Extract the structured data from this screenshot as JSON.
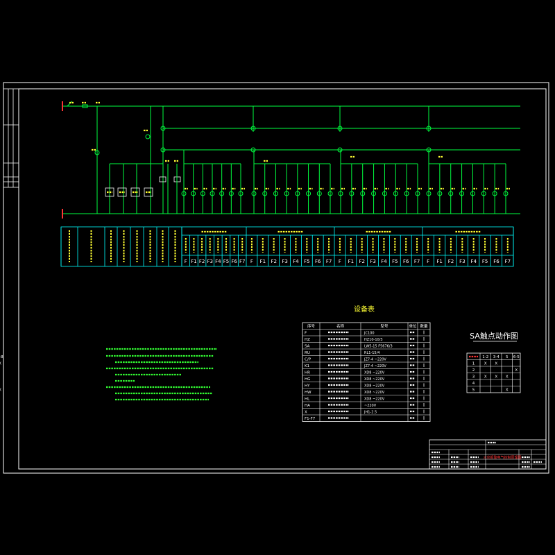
{
  "colors": {
    "frame": "#ffffff",
    "bus": "#00ff3f",
    "table": "#00ffff",
    "notes": "#33ff33",
    "accent_red": "#ff3333",
    "text_yellow": "#ffff33"
  },
  "terminal_row": {
    "codes": [
      "F",
      "F1",
      "F2",
      "F3",
      "F4",
      "F5",
      "F6",
      "F7",
      "F",
      "F1",
      "F2",
      "F3",
      "F4",
      "F5",
      "F6",
      "F7",
      "F",
      "F1",
      "F2",
      "F3",
      "F4",
      "F5",
      "F6",
      "F7",
      "F",
      "F1",
      "F2",
      "F3",
      "F4",
      "F5",
      "F6",
      "F7"
    ]
  },
  "device_table": {
    "title": "设备表",
    "headers": [
      "序号",
      "名称",
      "型号",
      "单位",
      "数量"
    ],
    "rows": [
      {
        "code": "F",
        "model": "JC100"
      },
      {
        "code": "HZ",
        "model": "HZ10-10/3"
      },
      {
        "code": "SA",
        "model": "LW5-15 F5676/3"
      },
      {
        "code": "RU",
        "model": "RL1-15/4"
      },
      {
        "code": "C/P",
        "model": "JZ7-4 ~220V"
      },
      {
        "code": "K1",
        "model": "JZ7-4 ~220V"
      },
      {
        "code": "HR",
        "model": "XD8 ~220V"
      },
      {
        "code": "HG",
        "model": "XD8 ~220V"
      },
      {
        "code": "HY",
        "model": "XD8 ~220V"
      },
      {
        "code": "HW",
        "model": "XD8 ~220V"
      },
      {
        "code": "HL",
        "model": "XD8 ~220V"
      },
      {
        "code": "HA",
        "model": "~220V"
      },
      {
        "code": "X",
        "model": "JH1-2.5"
      },
      {
        "code": "F1-F7",
        "model": ""
      }
    ]
  },
  "contact_table": {
    "title": "SA触点动作图",
    "headers": [
      "",
      "1-2",
      "3-4",
      "5",
      "6-5",
      "7-8"
    ],
    "rows": [
      [
        "1",
        "X",
        "X",
        "",
        "",
        "X"
      ],
      [
        "2",
        "",
        "",
        "",
        "X",
        ""
      ],
      [
        "3",
        "X",
        "X",
        "X",
        "",
        ""
      ],
      [
        "4",
        "",
        "",
        "",
        "",
        ""
      ],
      [
        "5",
        "",
        "",
        "X",
        "",
        "X"
      ]
    ]
  },
  "title_block": {
    "project": "火灾报警电气控制原理图"
  }
}
